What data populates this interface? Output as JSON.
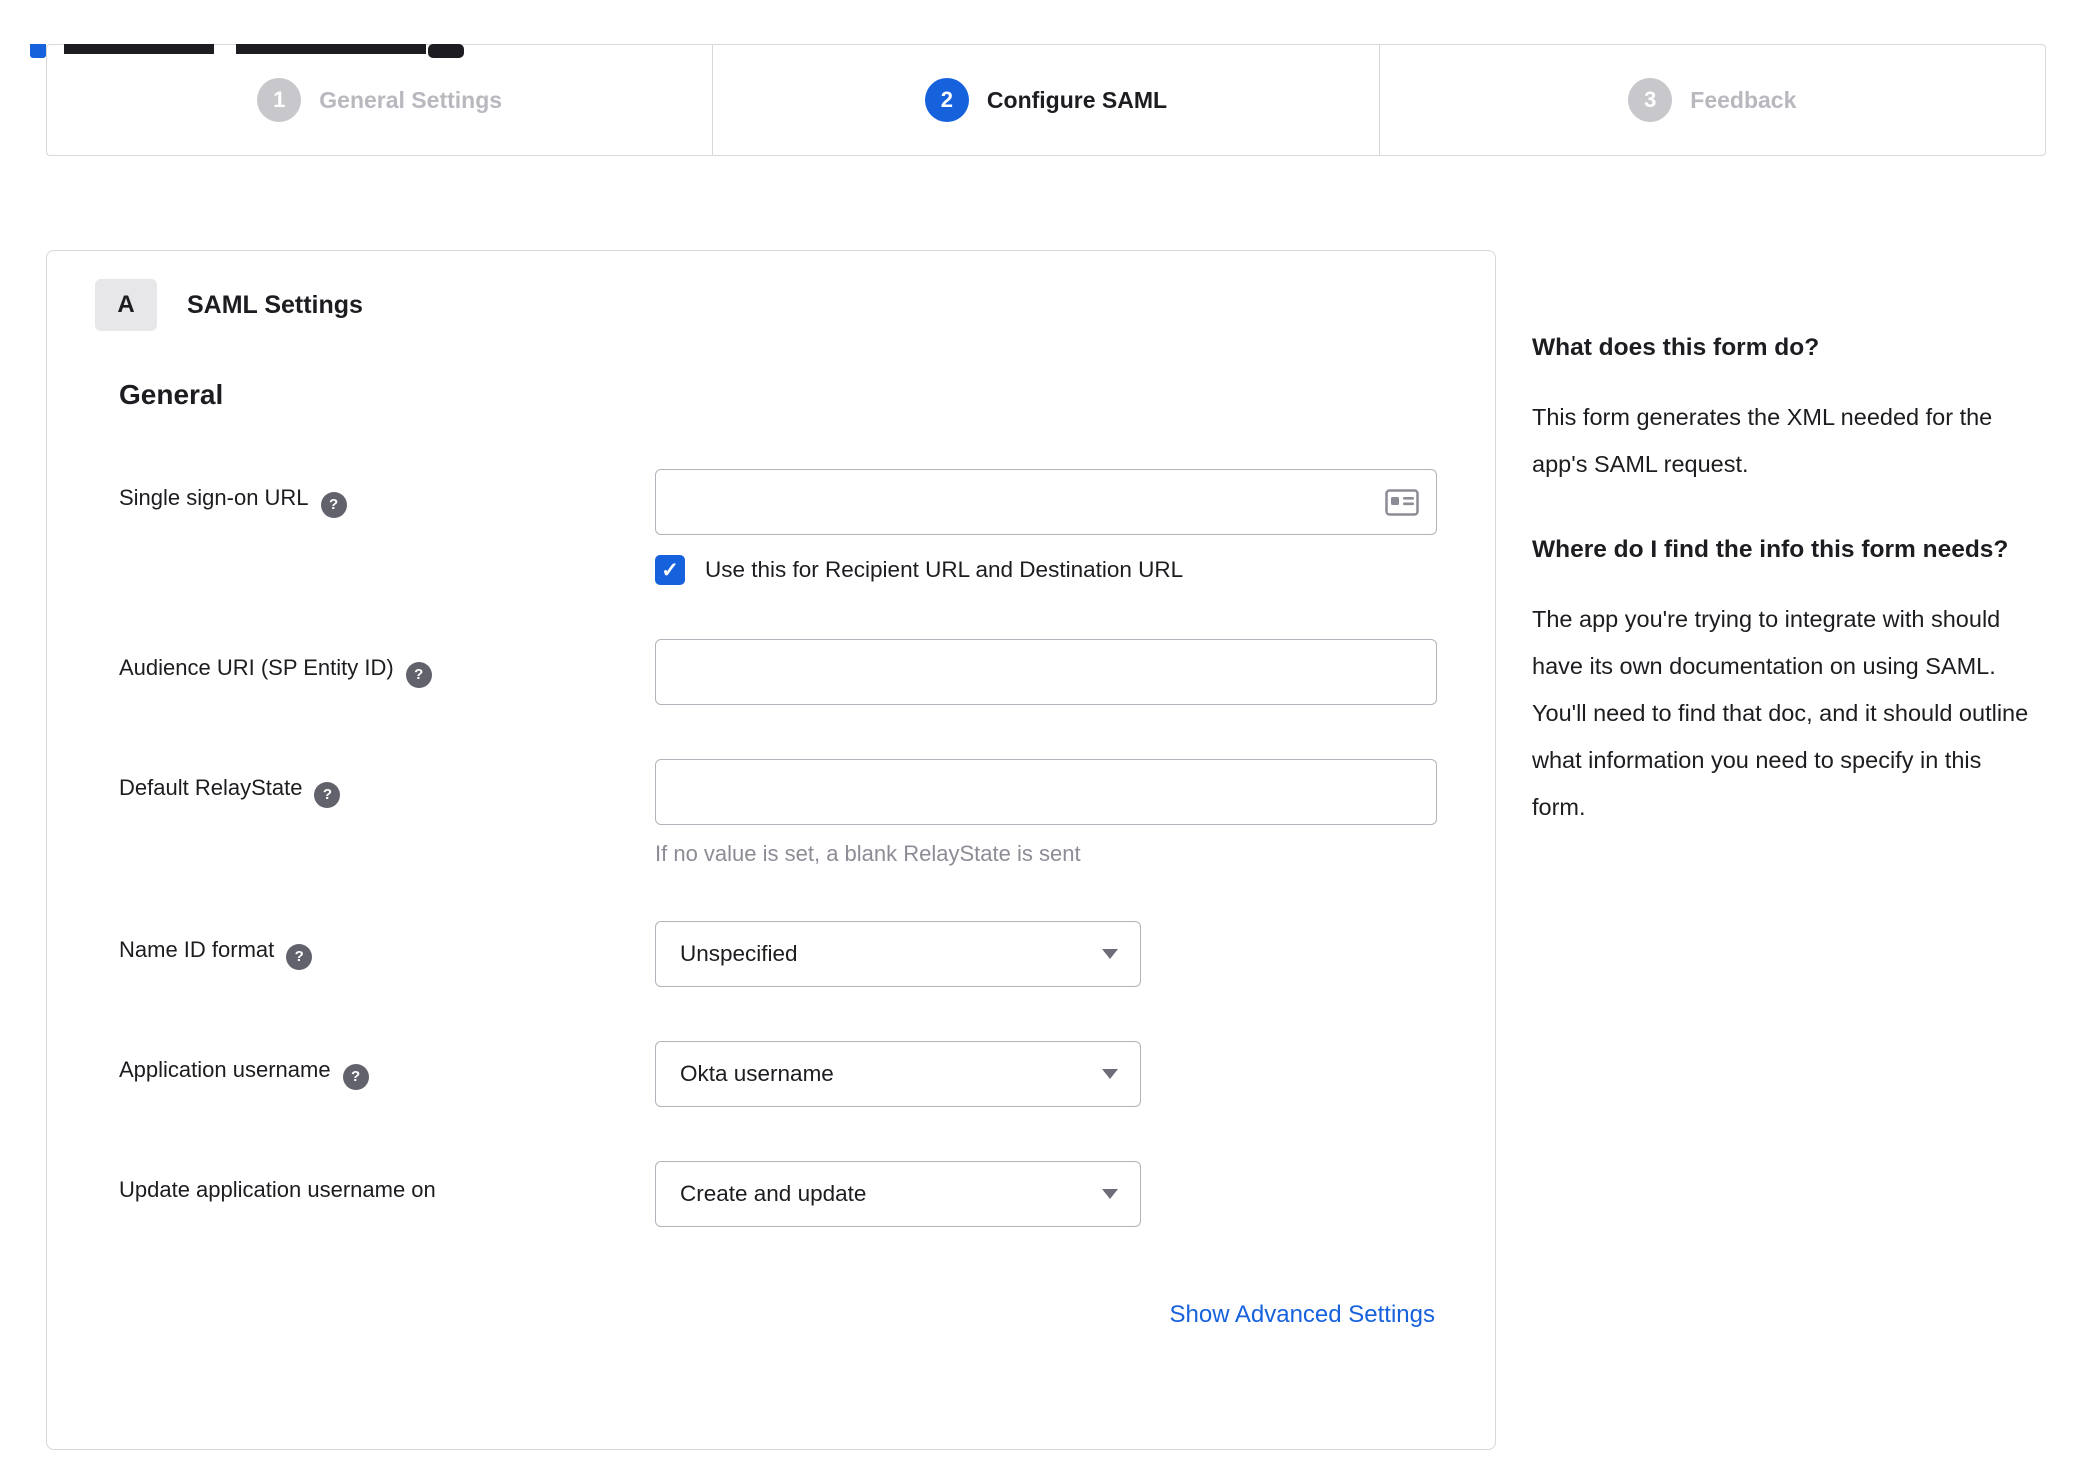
{
  "icons": {
    "help": "?",
    "check": "✓"
  },
  "colors": {
    "accent": "#1662dd",
    "muted_step": "#c7c7cc",
    "border": "#d7d7dc"
  },
  "stepper": {
    "steps": [
      {
        "number": "1",
        "label": "General Settings",
        "state": "inactive"
      },
      {
        "number": "2",
        "label": "Configure SAML",
        "state": "active"
      },
      {
        "number": "3",
        "label": "Feedback",
        "state": "inactive"
      }
    ]
  },
  "panel": {
    "section_badge": "A",
    "section_title": "SAML Settings",
    "group_title": "General",
    "fields": {
      "sso_url": {
        "label": "Single sign-on URL",
        "value": ""
      },
      "sso_checkbox_label": "Use this for Recipient URL and Destination URL",
      "audience_uri": {
        "label": "Audience URI (SP Entity ID)",
        "value": ""
      },
      "relay_state": {
        "label": "Default RelayState",
        "value": "",
        "hint": "If no value is set, a blank RelayState is sent"
      },
      "name_id_format": {
        "label": "Name ID format",
        "value": "Unspecified"
      },
      "app_username": {
        "label": "Application username",
        "value": "Okta username"
      },
      "update_app_username": {
        "label": "Update application username on",
        "value": "Create and update"
      }
    },
    "advanced_link": "Show Advanced Settings"
  },
  "sidebar": {
    "q1_title": "What does this form do?",
    "q1_body": "This form generates the XML needed for the app's SAML request.",
    "q2_title": "Where do I find the info this form needs?",
    "q2_body": "The app you're trying to integrate with should have its own documentation on using SAML. You'll need to find that doc, and it should outline what information you need to specify in this form."
  }
}
